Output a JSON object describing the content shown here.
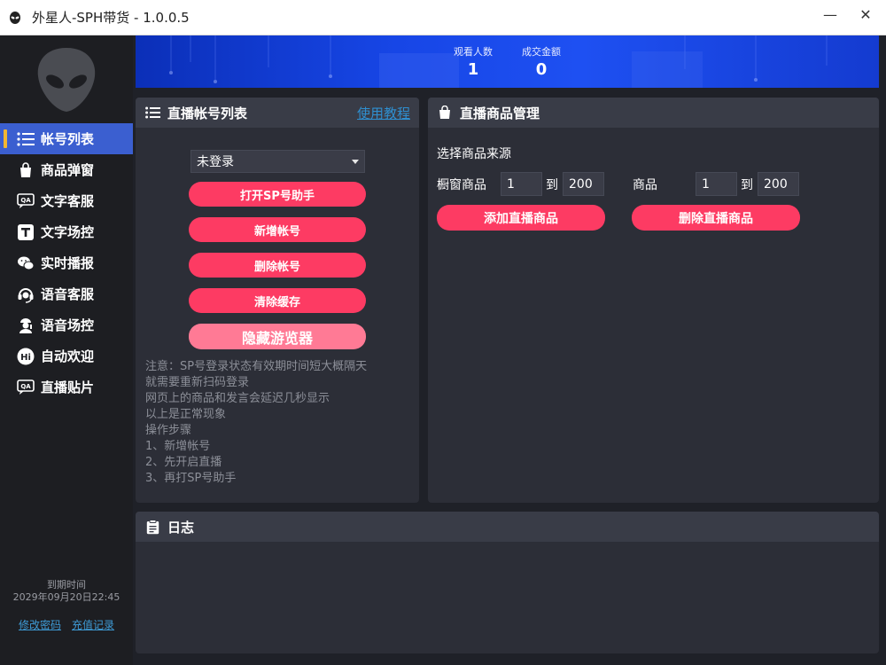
{
  "window": {
    "title": "外星人-SPH带货 - 1.0.0.5",
    "minimize": "—",
    "close": "✕"
  },
  "banner": {
    "viewers_label": "观看人数",
    "viewers_value": "1",
    "amount_label": "成交金额",
    "amount_value": "0"
  },
  "sidebar": {
    "items": [
      {
        "label": "帐号列表",
        "icon": "list-icon",
        "active": true
      },
      {
        "label": "商品弹窗",
        "icon": "shopping-bag-icon"
      },
      {
        "label": "文字客服",
        "icon": "chat-qa-icon"
      },
      {
        "label": "文字场控",
        "icon": "text-t-icon"
      },
      {
        "label": "实时播报",
        "icon": "wechat-icon"
      },
      {
        "label": "语音客服",
        "icon": "headset-icon"
      },
      {
        "label": "语音场控",
        "icon": "mic-person-icon"
      },
      {
        "label": "自动欢迎",
        "icon": "hi-icon"
      },
      {
        "label": "直播贴片",
        "icon": "sticker-qa-icon"
      }
    ],
    "expiry_label": "到期时间",
    "expiry_value": "2029年09月20日22:45",
    "change_password": "修改密码",
    "recharge_record": "充值记录"
  },
  "accounts": {
    "title": "直播帐号列表",
    "tutorial": "使用教程",
    "login_select": "未登录",
    "buttons": {
      "open_helper": "打开SP号助手",
      "add_account": "新增帐号",
      "delete_account": "删除帐号",
      "clear_cache": "清除缓存",
      "hide_browser": "隐藏游览器"
    },
    "notes": [
      "注意：SP号登录状态有效期时间短大概隔天",
      "就需要重新扫码登录",
      "网页上的商品和发言会延迟几秒显示",
      "以上是正常现象",
      "操作步骤",
      "1、新增帐号",
      "2、先开启直播",
      "3、再打SP号助手"
    ]
  },
  "goods": {
    "title": "直播商品管理",
    "source_label": "选择商品来源",
    "window_goods_label": "橱窗商品",
    "window_from": "1",
    "window_to": "200",
    "goods_label": "商品",
    "goods_from": "1",
    "goods_to": "200",
    "to_text": "到",
    "add_button": "添加直播商品",
    "delete_button": "删除直播商品"
  },
  "log": {
    "title": "日志"
  },
  "colors": {
    "accent": "#fd3b63",
    "active_nav": "#3b5fd0",
    "active_marker": "#f2b632",
    "link": "#2f8fd0"
  }
}
